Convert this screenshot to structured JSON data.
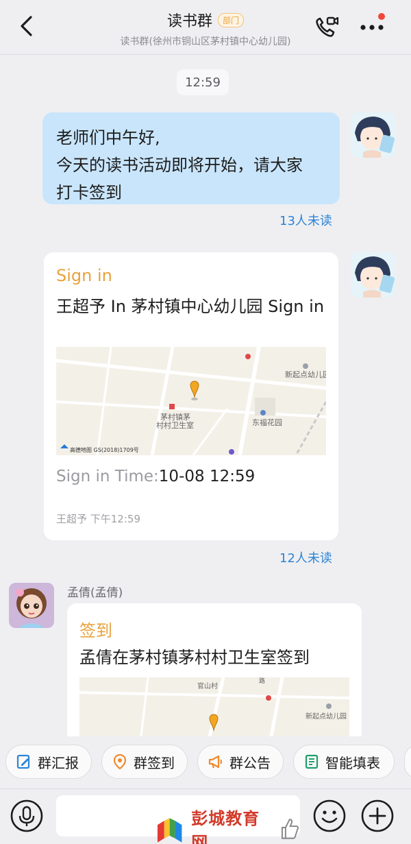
{
  "header": {
    "title": "读书群",
    "badge": "部门",
    "subtitle": "读书群(徐州市铜山区茅村镇中心幼儿园)"
  },
  "timestamp": "12:59",
  "messages": {
    "first": {
      "lines": [
        "老师们中午好,",
        "今天的读书活动即将开始，请大家",
        "打卡签到"
      ],
      "unread": "13人未读"
    },
    "second": {
      "tag": "Sign in",
      "body": "王超予 In 茅村镇中心幼儿园 Sign in",
      "map": {
        "labels": [
          "新起点幼儿园",
          "茅村镇茅",
          "村村卫生室",
          "东福花园",
          "高德地图  GS(2018)1709号"
        ]
      },
      "time_label": "Sign in Time:",
      "time_value": "10-08 12:59",
      "footer": "王超予 下午12:59",
      "unread": "12人未读"
    },
    "third": {
      "sender": "孟倩(孟倩)",
      "tag": "签到",
      "body": "孟倩在茅村镇茅村村卫生室签到",
      "map": {
        "labels": [
          "官山村",
          "新起点幼儿园",
          "路"
        ]
      }
    }
  },
  "quick_actions": [
    {
      "label": "群汇报",
      "icon": "report-icon",
      "color": "#2b84d6"
    },
    {
      "label": "群签到",
      "icon": "location-pin-icon",
      "color": "#f08a2c"
    },
    {
      "label": "群公告",
      "icon": "megaphone-icon",
      "color": "#f08a2c"
    },
    {
      "label": "智能填表",
      "icon": "form-icon",
      "color": "#1f9e6a"
    }
  ],
  "input_bar": {
    "watermark": "彭城教育网"
  }
}
